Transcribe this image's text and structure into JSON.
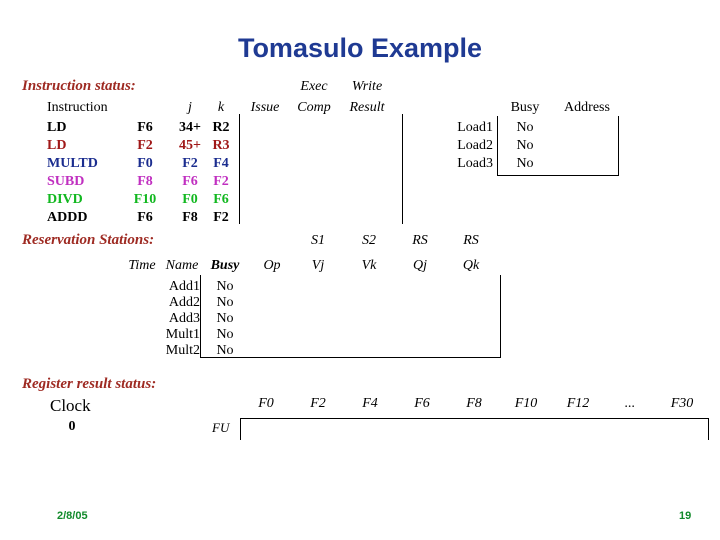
{
  "slide": {
    "title": "Tomasulo Example",
    "title_color": "#1f3a93",
    "heading_color": "#9e2a22",
    "footer": {
      "date": "2/8/05",
      "page": "19",
      "color": "#128a2b"
    }
  },
  "instruction_status": {
    "heading": "Instruction status:",
    "headers": {
      "instruction": "Instruction",
      "j": "j",
      "k": "k",
      "issue": "Issue",
      "exec": "Exec",
      "comp": "Comp",
      "write": "Write",
      "result": "Result"
    },
    "rows": [
      {
        "op": "LD",
        "dest": "F6",
        "j": "34+",
        "k": "R2",
        "issue": "",
        "exec_comp": "",
        "write_result": "",
        "color": "#000000"
      },
      {
        "op": "LD",
        "dest": "F2",
        "j": "45+",
        "k": "R3",
        "issue": "",
        "exec_comp": "",
        "write_result": "",
        "color": "#a01818"
      },
      {
        "op": "MULTD",
        "dest": "F0",
        "j": "F2",
        "k": "F4",
        "issue": "",
        "exec_comp": "",
        "write_result": "",
        "color": "#1b2d8f"
      },
      {
        "op": "SUBD",
        "dest": "F8",
        "j": "F6",
        "k": "F2",
        "issue": "",
        "exec_comp": "",
        "write_result": "",
        "color": "#c02fc0"
      },
      {
        "op": "DIVD",
        "dest": "F10",
        "j": "F0",
        "k": "F6",
        "issue": "",
        "exec_comp": "",
        "write_result": "",
        "color": "#12b820"
      },
      {
        "op": "ADDD",
        "dest": "F6",
        "j": "F8",
        "k": "F2",
        "issue": "",
        "exec_comp": "",
        "write_result": "",
        "color": "#000000"
      }
    ]
  },
  "load_buffers": {
    "headers": {
      "busy": "Busy",
      "address": "Address"
    },
    "rows": [
      {
        "name": "Load1",
        "busy": "No",
        "address": ""
      },
      {
        "name": "Load2",
        "busy": "No",
        "address": ""
      },
      {
        "name": "Load3",
        "busy": "No",
        "address": ""
      }
    ]
  },
  "reservation_stations": {
    "heading": "Reservation Stations:",
    "headers": {
      "time": "Time",
      "name": "Name",
      "busy": "Busy",
      "op": "Op",
      "s1": "S1",
      "vj": "Vj",
      "s2": "S2",
      "vk": "Vk",
      "rs_qj_top": "RS",
      "qj": "Qj",
      "rs_qk_top": "RS",
      "qk": "Qk"
    },
    "rows": [
      {
        "time": "",
        "name": "Add1",
        "busy": "No",
        "op": "",
        "vj": "",
        "vk": "",
        "qj": "",
        "qk": ""
      },
      {
        "time": "",
        "name": "Add2",
        "busy": "No",
        "op": "",
        "vj": "",
        "vk": "",
        "qj": "",
        "qk": ""
      },
      {
        "time": "",
        "name": "Add3",
        "busy": "No",
        "op": "",
        "vj": "",
        "vk": "",
        "qj": "",
        "qk": ""
      },
      {
        "time": "",
        "name": "Mult1",
        "busy": "No",
        "op": "",
        "vj": "",
        "vk": "",
        "qj": "",
        "qk": ""
      },
      {
        "time": "",
        "name": "Mult2",
        "busy": "No",
        "op": "",
        "vj": "",
        "vk": "",
        "qj": "",
        "qk": ""
      }
    ]
  },
  "register_result_status": {
    "heading": "Register result status:",
    "clock_label": "Clock",
    "clock_value": "0",
    "fu_label": "FU",
    "registers": [
      "F0",
      "F2",
      "F4",
      "F6",
      "F8",
      "F10",
      "F12",
      "...",
      "F30"
    ],
    "values": [
      "",
      "",
      "",
      "",
      "",
      "",
      "",
      "",
      ""
    ]
  }
}
